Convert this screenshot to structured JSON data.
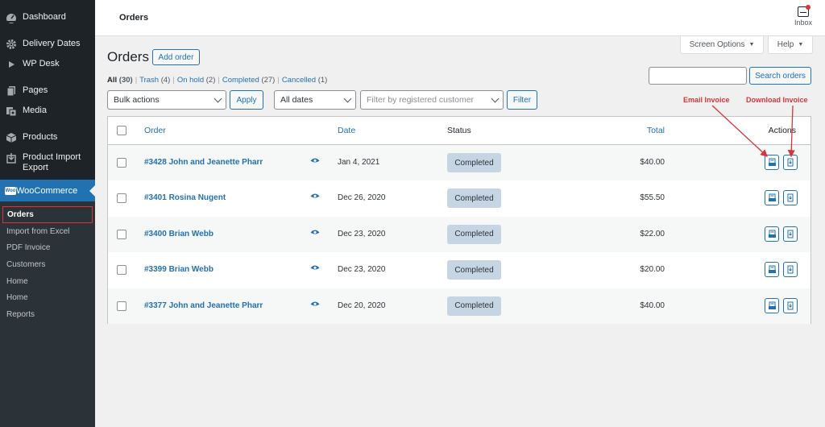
{
  "sidebar": {
    "items": [
      {
        "label": "Dashboard",
        "icon": "dashboard-icon"
      },
      {
        "label": "Delivery Dates",
        "icon": "gear-icon"
      },
      {
        "label": "WP Desk",
        "icon": "play-icon"
      },
      {
        "label": "Pages",
        "icon": "pages-icon"
      },
      {
        "label": "Media",
        "icon": "media-icon"
      },
      {
        "label": "Products",
        "icon": "products-icon"
      },
      {
        "label": "Product Import Export",
        "icon": "import-export-icon"
      }
    ],
    "active": {
      "label": "WooCommerce",
      "icon": "woocommerce-icon",
      "logo_text": "Woo"
    },
    "submenu": [
      "Orders",
      "Import from Excel",
      "PDF Invoice",
      "Customers",
      "Home",
      "Home",
      "Reports"
    ]
  },
  "header": {
    "title": "Orders",
    "inbox_label": "Inbox",
    "screen_options": "Screen Options",
    "help": "Help"
  },
  "main": {
    "title": "Orders",
    "add_order": "Add order",
    "views": [
      {
        "label": "All",
        "count": "(30)",
        "current": true
      },
      {
        "label": "Trash",
        "count": "(4)"
      },
      {
        "label": "On hold",
        "count": "(2)"
      },
      {
        "label": "Completed",
        "count": "(27)"
      },
      {
        "label": "Cancelled",
        "count": "(1)"
      }
    ],
    "separator": "|",
    "bulk_actions": "Bulk actions",
    "apply": "Apply",
    "dates": "All dates",
    "customer_placeholder": "Filter by registered customer",
    "filter": "Filter",
    "search_value": "",
    "search_button": "Search orders"
  },
  "annotations": {
    "email": "Email Invoice",
    "download": "Download Invoice",
    "color": "#d63638"
  },
  "table": {
    "columns": {
      "order": "Order",
      "date": "Date",
      "status": "Status",
      "total": "Total",
      "actions": "Actions"
    },
    "rows": [
      {
        "order": "#3428 John and Jeanette Pharr",
        "date": "Jan 4, 2021",
        "status": "Completed",
        "total": "$40.00"
      },
      {
        "order": "#3401 Rosina Nugent",
        "date": "Dec 26, 2020",
        "status": "Completed",
        "total": "$55.50"
      },
      {
        "order": "#3400 Brian Webb",
        "date": "Dec 23, 2020",
        "status": "Completed",
        "total": "$22.00"
      },
      {
        "order": "#3399 Brian Webb",
        "date": "Dec 23, 2020",
        "status": "Completed",
        "total": "$20.00"
      },
      {
        "order": "#3377 John and Jeanette Pharr",
        "date": "Dec 20, 2020",
        "status": "Completed",
        "total": "$40.00"
      }
    ]
  },
  "colors": {
    "accent": "#2271b1",
    "sidebar_bg": "#1d2327",
    "status_completed_bg": "#c6d5e3"
  }
}
